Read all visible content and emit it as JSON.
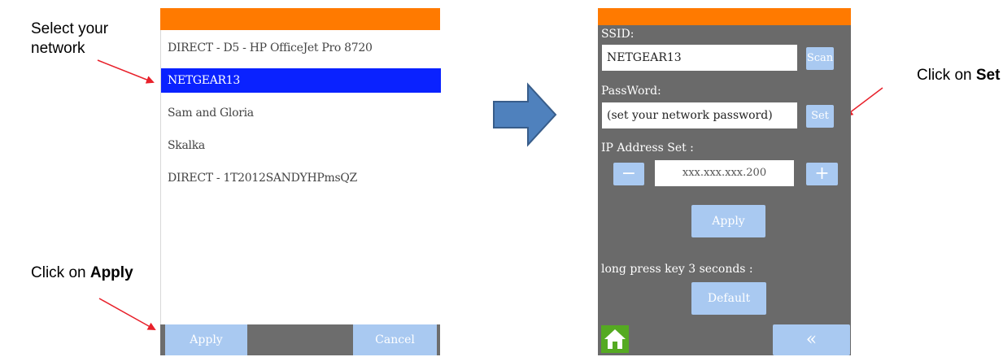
{
  "annotations": {
    "select_network": "Select your network",
    "click_apply_prefix": "Click on ",
    "click_apply_bold": "Apply",
    "click_set_prefix": "Click on ",
    "click_set_bold": "Set"
  },
  "left_screen": {
    "networks": [
      "DIRECT - D5 - HP OfficeJet Pro 8720",
      "NETGEAR13",
      "Sam and Gloria",
      "Skalka",
      "DIRECT - 1T2012SANDYHPmsQZ"
    ],
    "selected_network": "NETGEAR13",
    "apply_label": "Apply",
    "cancel_label": "Cancel"
  },
  "right_screen": {
    "ssid_label": "SSID:",
    "ssid_value": "NETGEAR13",
    "scan_label": "Scan",
    "password_label": "PassWord:",
    "password_value": "(set your network password)",
    "set_label": "Set",
    "ip_label": "IP Address Set :",
    "minus_label": "−",
    "ip_value": "xxx.xxx.xxx.200",
    "plus_label": "+",
    "apply_label": "Apply",
    "long_press_label": "long press key 3 seconds :",
    "default_label": "Default",
    "back_label": "«"
  },
  "colors": {
    "accent_orange": "#ff7a00",
    "selected_blue": "#0a22ff",
    "button_blue": "#a9c9f1",
    "panel_gray": "#6a6a6a",
    "arrow_red": "#e8202a",
    "home_green": "#55aa22"
  },
  "icons": {
    "home": "home-icon",
    "flow_arrow": "right-arrow-icon"
  }
}
